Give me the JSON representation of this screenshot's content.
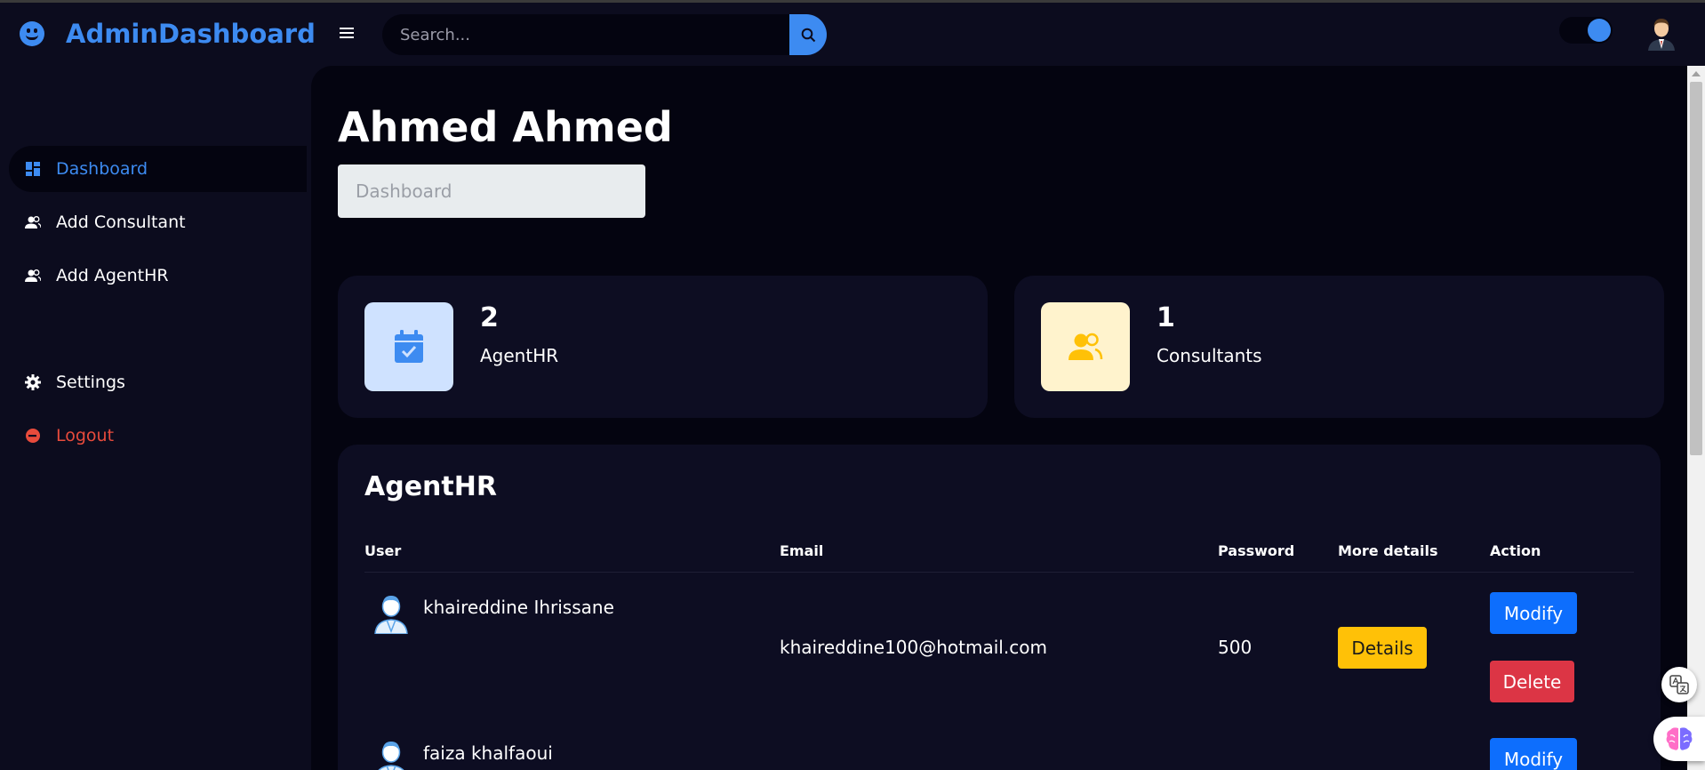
{
  "app": {
    "brand_name": "AdminDashboard",
    "brand_icon": "smile-icon"
  },
  "header": {
    "search": {
      "placeholder": "Search..."
    },
    "theme_toggle": {
      "on": true
    },
    "accent": "#3d8bf1"
  },
  "sidebar": {
    "items": [
      {
        "label": "Dashboard",
        "icon": "grid-icon",
        "active": true
      },
      {
        "label": "Add Consultant",
        "icon": "users-icon"
      },
      {
        "label": "Add AgentHR",
        "icon": "users-icon"
      },
      {
        "label": "Settings",
        "icon": "gear-icon"
      },
      {
        "label": "Logout",
        "icon": "logout-icon",
        "color": "#e84b3c"
      }
    ]
  },
  "main": {
    "title": "Ahmed Ahmed",
    "breadcrumb": "Dashboard",
    "stats": [
      {
        "value": "2",
        "label": "AgentHR",
        "icon": "calendar-check-icon",
        "icon_bg": "#cfe2ff",
        "icon_color": "#3d8bf1"
      },
      {
        "value": "1",
        "label": "Consultants",
        "icon": "users-icon",
        "icon_bg": "#fff3cd",
        "icon_color": "#ffc107"
      }
    ],
    "table": {
      "title": "AgentHR",
      "columns": [
        "User",
        "Email",
        "Password",
        "More details",
        "Action"
      ],
      "rows": [
        {
          "name": "khaireddine Ihrissane",
          "email": "khaireddine100@hotmail.com",
          "password": "500",
          "details_label": "Details",
          "modify_label": "Modify",
          "delete_label": "Delete"
        },
        {
          "name": "faiza khalfaoui",
          "modify_label": "Modify"
        }
      ]
    }
  },
  "colors": {
    "background": "#0c0c1e",
    "content_bg": "#040410",
    "card_bg": "#0d0d22",
    "modify": "#0d6efd",
    "delete": "#dc3545",
    "details": "#ffc107"
  }
}
